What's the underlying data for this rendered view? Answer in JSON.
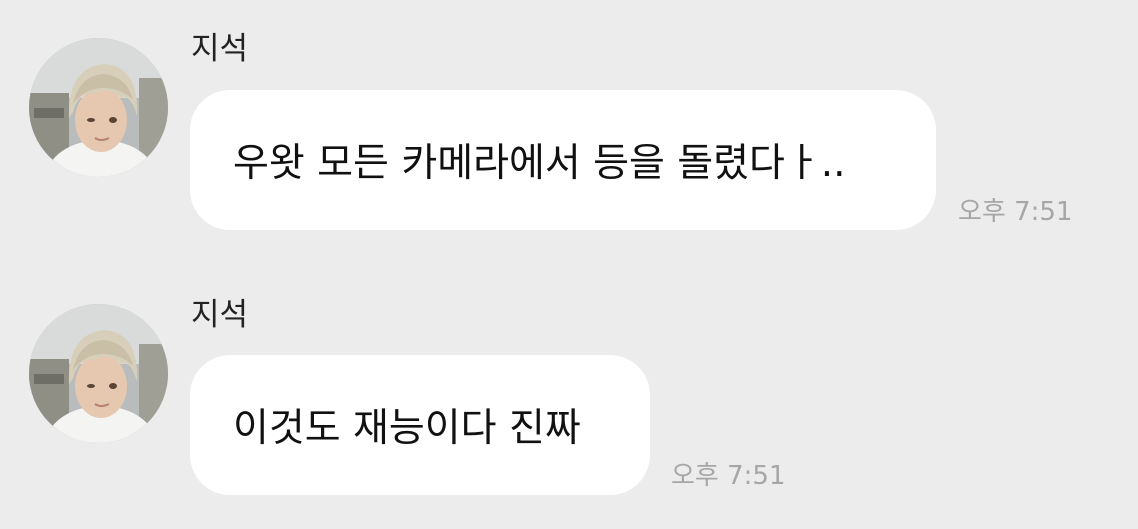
{
  "messages": [
    {
      "sender": "지석",
      "text": "우왓 모든 카메라에서 등을 돌렸다ㅏ..",
      "time": "오후 7:51",
      "avatar": "profile-photo"
    },
    {
      "sender": "지석",
      "text": "이것도 재능이다 진짜",
      "time": "오후 7:51",
      "avatar": "profile-photo"
    }
  ],
  "colors": {
    "background": "#ececec",
    "bubble": "#ffffff",
    "timestamp": "#a6a6a6"
  }
}
